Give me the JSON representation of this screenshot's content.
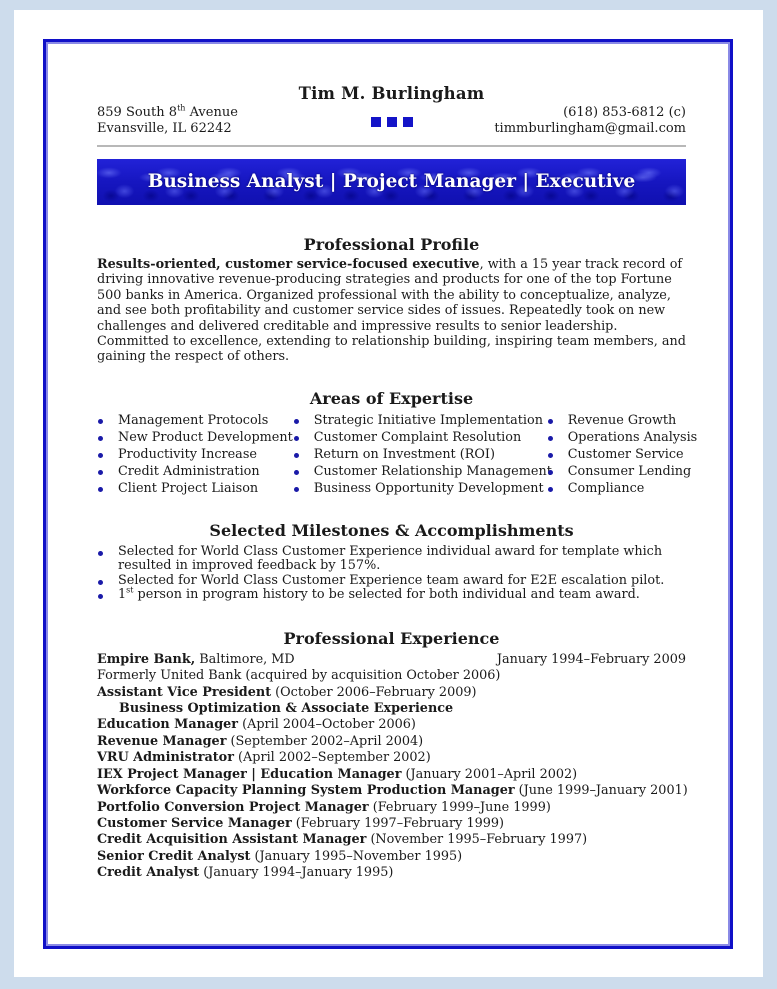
{
  "header": {
    "name": "Tim M. Burlingham",
    "address_line1_pre": "859 South 8",
    "address_line1_sup": "th",
    "address_line1_post": " Avenue",
    "address_line2": "Evansville, IL 62242",
    "phone": "(618) 853-6812 (c)",
    "email": "timmburlingham@gmail.com",
    "accent_color": "#1414c8"
  },
  "banner": {
    "title": "Business Analyst | Project Manager | Executive"
  },
  "profile": {
    "heading": "Professional Profile",
    "lead_bold": "Results-oriented, customer service-focused executive",
    "body": ", with a 15 year track record of driving innovative revenue-producing strategies and products for one of the top Fortune 500 banks in America. Organized professional with the ability to conceptualize, analyze, and see both profitability and customer service sides of issues. Repeatedly took on new challenges and delivered creditable and impressive results to senior leadership. Committed to excellence, extending to relationship building, inspiring team members, and gaining the respect of others."
  },
  "expertise": {
    "heading": "Areas of Expertise",
    "columns": [
      [
        "Management Protocols",
        "New Product Development",
        "Productivity Increase",
        "Credit Administration",
        "Client Project Liaison"
      ],
      [
        "Strategic Initiative Implementation",
        "Customer Complaint Resolution",
        "Return on Investment (ROI)",
        "Customer Relationship Management",
        "Business Opportunity Development"
      ],
      [
        "Revenue Growth",
        "Operations Analysis",
        "Customer Service",
        "Consumer Lending",
        "Compliance"
      ]
    ]
  },
  "milestones": {
    "heading": "Selected Milestones & Accomplishments",
    "items": [
      {
        "text": "Selected for World Class Customer Experience individual award for template which resulted in improved feedback by 157%."
      },
      {
        "text": "Selected for World Class Customer Experience team award for E2E escalation pilot."
      },
      {
        "pre": "1",
        "sup": "st",
        "text": " person in program history to be selected for both individual and team award."
      }
    ]
  },
  "experience": {
    "heading": "Professional Experience",
    "employer_bold": "Empire Bank,",
    "employer_location": " Baltimore, MD",
    "employer_dates": "January 1994–February 2009",
    "employer_note": "Formerly United Bank (acquired by acquisition October 2006)",
    "roles": [
      {
        "title": "Assistant Vice President",
        "dates": " (October 2006–February 2009)"
      },
      {
        "title": "Business Optimization & Associate Experience",
        "dates": "",
        "indent": true
      },
      {
        "title": "Education Manager",
        "dates": " (April 2004–October 2006)"
      },
      {
        "title": "Revenue Manager",
        "dates": " (September 2002–April 2004)"
      },
      {
        "title": "VRU Administrator",
        "dates": " (April 2002–September 2002)"
      },
      {
        "title": "IEX Project Manager | Education Manager",
        "dates": " (January 2001–April 2002)"
      },
      {
        "title": "Workforce Capacity Planning System Production Manager",
        "dates": " (June 1999–January 2001)"
      },
      {
        "title": "Portfolio Conversion Project Manager",
        "dates": " (February 1999–June 1999)"
      },
      {
        "title": "Customer Service Manager",
        "dates": " (February 1997–February 1999)"
      },
      {
        "title": "Credit Acquisition Assistant Manager",
        "dates": " (November 1995–February 1997)"
      },
      {
        "title": "Senior Credit Analyst",
        "dates": " (January 1995–November 1995)"
      },
      {
        "title": "Credit Analyst",
        "dates": " (January 1994–January 1995)"
      }
    ]
  }
}
